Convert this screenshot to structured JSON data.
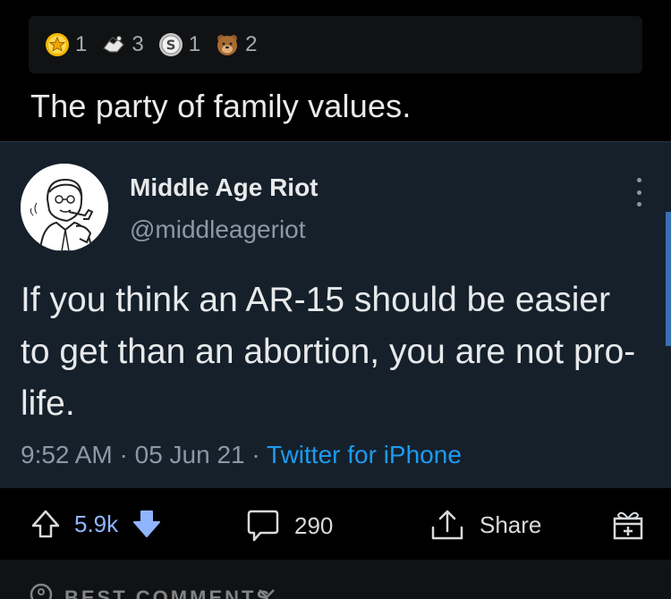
{
  "awards": [
    {
      "icon": "gold-star-award-icon",
      "count": "1"
    },
    {
      "icon": "wholesome-award-icon",
      "count": "3"
    },
    {
      "icon": "silver-award-icon",
      "count": "1"
    },
    {
      "icon": "bear-award-icon",
      "count": "2"
    }
  ],
  "post": {
    "title": "The party of family values."
  },
  "tweet": {
    "display_name": "Middle Age Riot",
    "handle": "@middleageriot",
    "text": "If you think an AR-15 should be easier to get than an abortion, you are not pro-life.",
    "time": "9:52 AM",
    "date": "05 Jun 21",
    "separator": " · ",
    "source": "Twitter for iPhone"
  },
  "actions": {
    "votes": "5.9k",
    "comments": "290",
    "share": "Share"
  },
  "comments_sort": {
    "label": "BEST COMMENTS"
  },
  "colors": {
    "tweet_bg": "#15202b",
    "twitter_blue": "#1d9bf0",
    "vote_blue": "#8fb5ff"
  }
}
